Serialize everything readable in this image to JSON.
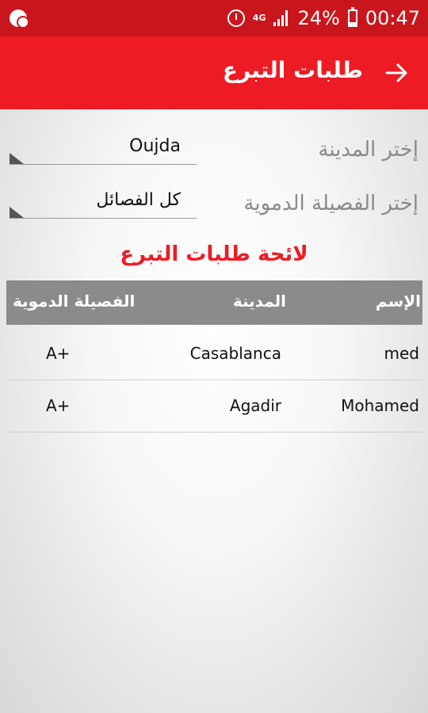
{
  "status_bar": {
    "network": "4G",
    "battery": "24%",
    "time": "00:47",
    "icons": [
      "notification-icon",
      "alarm-icon",
      "signal-icon",
      "battery-icon"
    ]
  },
  "toolbar": {
    "title": "طلبات التبرع",
    "back_icon": "arrow-right-icon"
  },
  "filters": {
    "city": {
      "label": "إختر المدينة",
      "value": "Oujda"
    },
    "blood": {
      "label": "إختر الفصيلة الدموية",
      "value": "كل الفصائل"
    }
  },
  "list_title": "لائحة طلبات التبرع",
  "table": {
    "headers": {
      "name": "الإسم",
      "city": "المدينة",
      "blood": "الفصيلة الدموية"
    },
    "rows": [
      {
        "name": "med",
        "city": "Casablanca",
        "blood": "A+"
      },
      {
        "name": "Mohamed",
        "city": "Agadir",
        "blood": "A+"
      }
    ]
  },
  "colors": {
    "status_bar": "#c9161d",
    "toolbar": "#ed1c24",
    "accent_text": "#ed1c24",
    "table_header": "#8b8b8b"
  }
}
